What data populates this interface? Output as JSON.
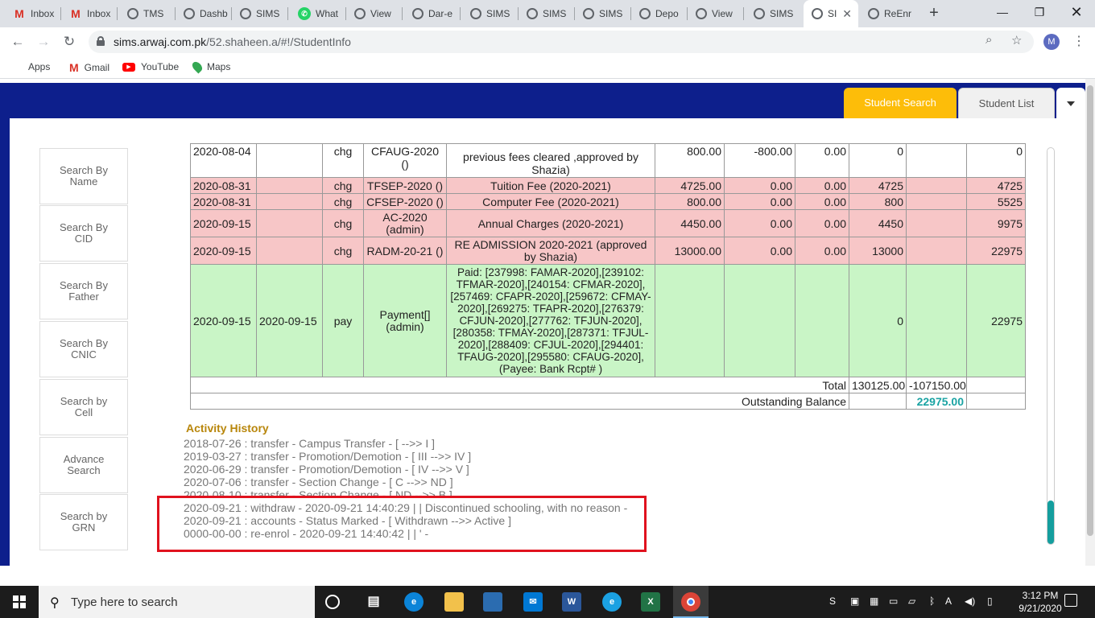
{
  "browser": {
    "tabs": [
      {
        "label": "Inbox",
        "icon": "gmail-icon"
      },
      {
        "label": "Inbox",
        "icon": "gmail-icon"
      },
      {
        "label": "TMS",
        "icon": "globe-icon"
      },
      {
        "label": "Dashb",
        "icon": "globe-icon"
      },
      {
        "label": "SIMS",
        "icon": "globe-icon"
      },
      {
        "label": "What",
        "icon": "whatsapp-icon"
      },
      {
        "label": "View",
        "icon": "globe-icon"
      },
      {
        "label": "Dar-e",
        "icon": "globe-icon"
      },
      {
        "label": "SIMS",
        "icon": "globe-icon"
      },
      {
        "label": "SIMS",
        "icon": "globe-icon"
      },
      {
        "label": "SIMS",
        "icon": "globe-icon"
      },
      {
        "label": "Depo",
        "icon": "globe-icon"
      },
      {
        "label": "View",
        "icon": "globe-icon"
      },
      {
        "label": "SIMS",
        "icon": "globe-icon"
      },
      {
        "label": "SI",
        "icon": "globe-icon",
        "active": true
      },
      {
        "label": "ReEnr",
        "icon": "globe-icon"
      }
    ],
    "url_host": "sims.arwaj.com.pk",
    "url_path": "/52.shaheen.a/#!/StudentInfo",
    "profile_initial": "M",
    "bookmarks": [
      {
        "label": "Apps",
        "icon": "apps-icon"
      },
      {
        "label": "Gmail",
        "icon": "gmail-icon"
      },
      {
        "label": "YouTube",
        "icon": "youtube-icon"
      },
      {
        "label": "Maps",
        "icon": "maps-icon"
      }
    ]
  },
  "page": {
    "nav_tabs": {
      "student_search": "Student Search",
      "student_list": "Student List"
    },
    "sidebar": [
      "Search By Name",
      "Search By CID",
      "Search By Father",
      "Search By CNIC",
      "Search by Cell",
      "Advance Search",
      "Search by GRN"
    ],
    "ledger": {
      "rows": [
        {
          "date": "2020-08-04",
          "paid_on": "",
          "type": "chg",
          "code": "CFAUG-2020 ()",
          "desc": "previous fees cleared ,approved by Shazia)",
          "amount": "800.00",
          "adj": "-800.00",
          "disc": "0.00",
          "net": "0",
          "paid": "",
          "balance": "0",
          "style": "white"
        },
        {
          "date": "2020-08-31",
          "paid_on": "",
          "type": "chg",
          "code": "TFSEP-2020 ()",
          "desc": "Tuition Fee (2020-2021)",
          "amount": "4725.00",
          "adj": "0.00",
          "disc": "0.00",
          "net": "4725",
          "paid": "",
          "balance": "4725",
          "style": "pink"
        },
        {
          "date": "2020-08-31",
          "paid_on": "",
          "type": "chg",
          "code": "CFSEP-2020 ()",
          "desc": "Computer Fee (2020-2021)",
          "amount": "800.00",
          "adj": "0.00",
          "disc": "0.00",
          "net": "800",
          "paid": "",
          "balance": "5525",
          "style": "pink"
        },
        {
          "date": "2020-09-15",
          "paid_on": "",
          "type": "chg",
          "code": "AC-2020 (admin)",
          "desc": "Annual Charges (2020-2021)",
          "amount": "4450.00",
          "adj": "0.00",
          "disc": "0.00",
          "net": "4450",
          "paid": "",
          "balance": "9975",
          "style": "pink"
        },
        {
          "date": "2020-09-15",
          "paid_on": "",
          "type": "chg",
          "code": "RADM-20-21 ()",
          "desc": "RE ADMISSION 2020-2021 (approved by Shazia)",
          "amount": "13000.00",
          "adj": "0.00",
          "disc": "0.00",
          "net": "13000",
          "paid": "",
          "balance": "22975",
          "style": "pink"
        },
        {
          "date": "2020-09-15",
          "paid_on": "2020-09-15",
          "type": "pay",
          "code": "Payment[] (admin)",
          "desc": "Paid: [237998: FAMAR-2020],[239102: TFMAR-2020],[240154: CFMAR-2020],[257469: CFAPR-2020],[259672: CFMAY-2020],[269275: TFAPR-2020],[276379: CFJUN-2020],[277762: TFJUN-2020],[280358: TFMAY-2020],[287371: TFJUL-2020],[288409: CFJUL-2020],[294401: TFAUG-2020],[295580: CFAUG-2020],(Payee: Bank Rcpt# )",
          "amount": "",
          "adj": "",
          "disc": "",
          "net": "0",
          "paid": "",
          "balance": "22975",
          "style": "green"
        }
      ],
      "total_label": "Total",
      "total_amount": "130125.00",
      "total_adj": "-107150.00",
      "outstanding_label": "Outstanding Balance",
      "outstanding_value": "22975.00"
    },
    "activity_title": "Activity History",
    "activity": [
      "2018-07-26 : transfer - Campus Transfer - [ -->> I ]",
      "2019-03-27 : transfer - Promotion/Demotion - [ III -->> IV ]",
      "2020-06-29 : transfer - Promotion/Demotion - [ IV -->> V ]",
      "2020-07-06 : transfer - Section Change - [ C -->> ND ]",
      "2020-08-10 : transfer - Section Change - [ ND -->> B ]",
      "2020-09-21 : withdraw - 2020-09-21 14:40:29 | | Discontinued schooling, with no reason -",
      "2020-09-21 : accounts - Status Marked - [ Withdrawn -->> Active ]",
      "0000-00-00 : re-enrol - 2020-09-21 14:40:42 | | ' -"
    ]
  },
  "taskbar": {
    "search_placeholder": "Type here to search",
    "time": "3:12 PM",
    "date": "9/21/2020",
    "apps": [
      "task-view-icon",
      "edge-icon",
      "file-explorer-icon",
      "store-icon",
      "mail-icon",
      "word-icon",
      "ie-icon",
      "excel-icon",
      "chrome-icon"
    ]
  }
}
